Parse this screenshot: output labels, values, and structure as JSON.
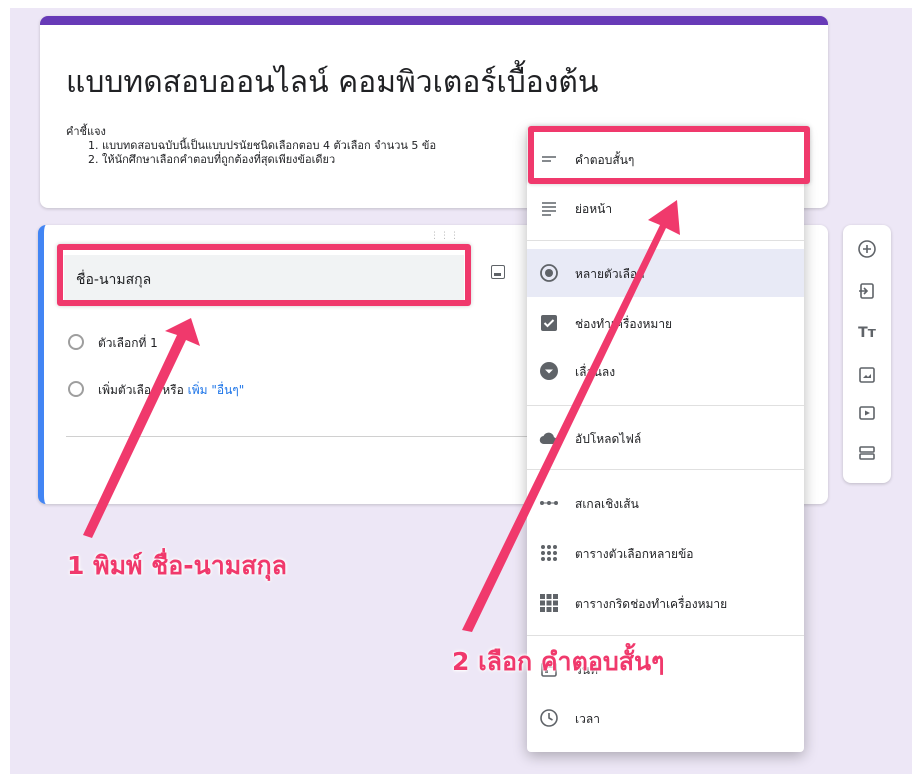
{
  "form": {
    "title": "แบบทดสอบออนไลน์ คอมพิวเตอร์เบื้องต้น",
    "description_label": "คำชี้แจง",
    "description_lines": [
      "1. แบบทดสอบฉบับนี้เป็นแบบปรนัยชนิดเลือกตอบ 4 ตัวเลือก จำนวน 5 ข้อ",
      "2. ให้นักศึกษาเลือกคำตอบที่ถูกต้องที่สุดเพียงข้อเดียว"
    ],
    "accent_color": "#673ab7"
  },
  "question": {
    "title_value": "ชื่อ-นามสกุล",
    "option1": "ตัวเลือกที่ 1",
    "add_option": "เพิ่มตัวเลือก",
    "or_text": "หรือ",
    "add_other": "เพิ่ม \"อื่นๆ\"",
    "border_color": "#4285f4"
  },
  "type_menu": {
    "items": [
      {
        "icon": "short-answer-icon",
        "label": "คำตอบสั้นๆ"
      },
      {
        "icon": "paragraph-icon",
        "label": "ย่อหน้า"
      },
      {
        "icon": "multiple-choice-icon",
        "label": "หลายตัวเลือก"
      },
      {
        "icon": "checkbox-icon",
        "label": "ช่องทำเครื่องหมาย"
      },
      {
        "icon": "dropdown-icon",
        "label": "เลื่อนลง"
      },
      {
        "icon": "cloud-upload-icon",
        "label": "อัปโหลดไฟล์"
      },
      {
        "icon": "linear-scale-icon",
        "label": "สเกลเชิงเส้น"
      },
      {
        "icon": "grid-icon",
        "label": "ตารางตัวเลือกหลายข้อ"
      },
      {
        "icon": "checkbox-grid-icon",
        "label": "ตารางกริดช่องทำเครื่องหมาย"
      },
      {
        "icon": "calendar-icon",
        "label": "วันที่"
      },
      {
        "icon": "clock-icon",
        "label": "เวลา"
      }
    ]
  },
  "side_toolbar": {
    "icons": [
      "add-question-icon",
      "import-questions-icon",
      "add-title-icon",
      "add-image-icon",
      "add-video-icon",
      "add-section-icon"
    ]
  },
  "annotations": {
    "step1": "1 พิมพ์ ชื่อ-นามสกุล",
    "step2": "2 เลือก คำตอบสั้นๆ",
    "color": "#f0396c"
  }
}
